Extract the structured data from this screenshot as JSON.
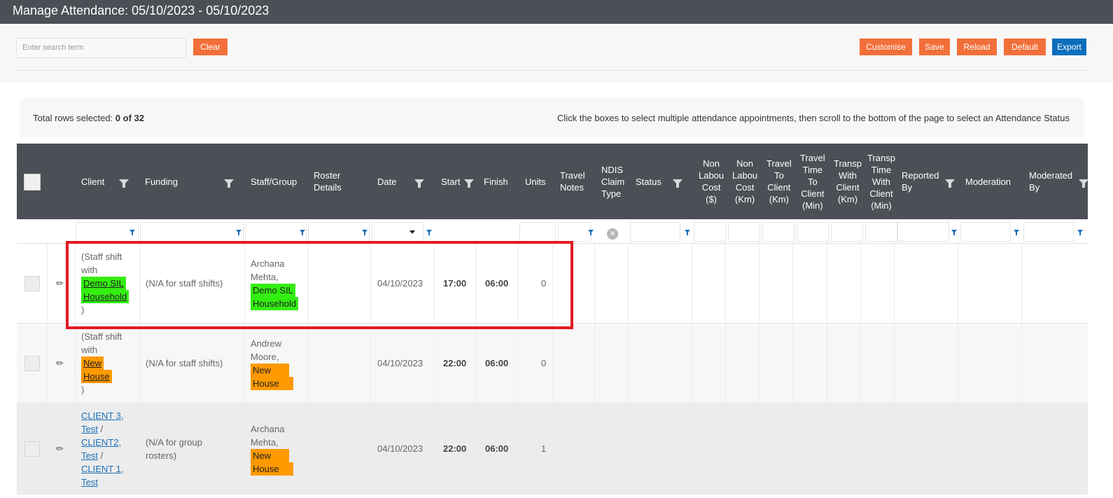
{
  "title": "Manage Attendance: 05/10/2023 - 05/10/2023",
  "search": {
    "placeholder": "Enter search term",
    "clear_label": "Clear"
  },
  "toolbar": {
    "customise": "Customise",
    "save": "Save",
    "reload": "Reload",
    "default": "Default",
    "export": "Export"
  },
  "info": {
    "selected_prefix": "Total rows selected: ",
    "selected_value": "0 of 32",
    "instructions": "Click the boxes to select multiple attendance appointments, then scroll to the bottom of the page to select an Attendance Status"
  },
  "columns": {
    "client": "Client",
    "funding": "Funding",
    "staff": "Staff/Group",
    "roster1": "Roster",
    "roster2": "Details",
    "date": "Date",
    "start": "Start",
    "finish": "Finish",
    "units": "Units",
    "travel_notes1": "Travel",
    "travel_notes2": "Notes",
    "ndis1": "NDIS",
    "ndis2": "Claim",
    "ndis3": "Type",
    "status": "Status",
    "nlc1": "Non",
    "nlc2": "Labou",
    "nlc3": "Cost",
    "nlc4": "($)",
    "nlk1": "Non",
    "nlk2": "Labou",
    "nlk3": "Cost",
    "nlk4": "(Km)",
    "ttc1": "Travel",
    "ttc2": "To",
    "ttc3": "Client",
    "ttc4": "(Km)",
    "ttm1": "Travel",
    "ttm2": "Time",
    "ttm3": "To",
    "ttm4": "Client",
    "ttm5": "(Min)",
    "tw1": "Transp",
    "tw2": "With",
    "tw3": "Client",
    "tw4": "(Km)",
    "tt1": "Transp",
    "tt2": "Time",
    "tt3": "With",
    "tt4": "Client",
    "tt5": "(Min)",
    "rep1": "Reported",
    "rep2": "By",
    "moderation": "Moderation",
    "mod1": "Moderated",
    "mod2": "By"
  },
  "rows": [
    {
      "client_a": "(Staff shift",
      "client_b": "with",
      "client_hl1": "Demo SIL",
      "client_hl2": "Household",
      "client_c": ")",
      "funding": "(N/A for staff shifts)",
      "staff_a": "Archana",
      "staff_b": "Mehta,",
      "staff_hl1": "Demo SIL",
      "staff_hl2": "Household",
      "date": "04/10/2023",
      "start": "17:00",
      "finish": "06:00",
      "units": "0",
      "highlight_color": "#33ee11"
    },
    {
      "client_a": "(Staff shift",
      "client_b": "with",
      "client_hl1": "New",
      "client_hl2": "House",
      "client_c": ")",
      "funding": "(N/A for staff shifts)",
      "staff_a": "Andrew",
      "staff_b": "Moore,",
      "staff_hl1": "New",
      "staff_hl2": "House",
      "date": "04/10/2023",
      "start": "22:00",
      "finish": "06:00",
      "units": "0",
      "highlight_color": "#ff9900"
    },
    {
      "client_l1": "CLIENT 3,",
      "client_l2": "Test",
      "client_l3": "CLIENT2,",
      "client_l4": "Test",
      "client_l5": "CLIENT 1,",
      "client_l6": "Test",
      "sep": "/",
      "funding_a": "(N/A for group",
      "funding_b": "rosters)",
      "staff_a": "Archana",
      "staff_b": "Mehta,",
      "staff_hl1": "New",
      "staff_hl2": "House",
      "date": "04/10/2023",
      "start": "22:00",
      "finish": "06:00",
      "units": "1",
      "highlight_color": "#ff9900"
    }
  ],
  "colors": {
    "header": "#4b4f56",
    "orange_button": "#f26f3a",
    "blue_button": "#0b6ebd",
    "highlight_box": "#e31b23"
  }
}
